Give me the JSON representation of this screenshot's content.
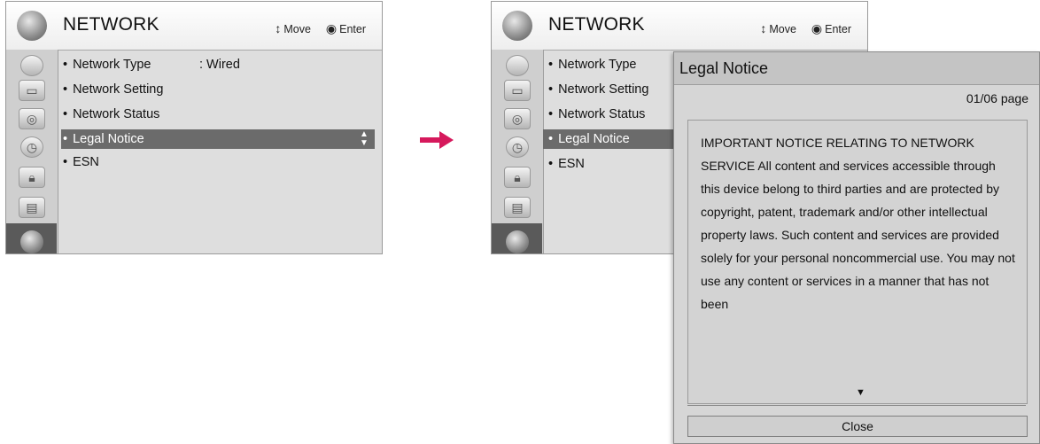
{
  "left_screen": {
    "title": "NETWORK",
    "hint": {
      "move_icon": "move-icon",
      "move_label": "Move",
      "enter_icon": "enter-icon",
      "enter_label": "Enter"
    },
    "menu": [
      {
        "label": "Network Type",
        "value": ": Wired"
      },
      {
        "label": "Network Setting"
      },
      {
        "label": "Network Status"
      },
      {
        "label": "Legal Notice",
        "selected": true
      },
      {
        "label": "ESN"
      }
    ]
  },
  "right_screen": {
    "title": "NETWORK",
    "hint": {
      "move_label": "Move",
      "enter_label": "Enter"
    },
    "menu": [
      {
        "label": "Network Type"
      },
      {
        "label": "Network Setting"
      },
      {
        "label": "Network Status"
      },
      {
        "label": "Legal Notice",
        "selected": true
      },
      {
        "label": "ESN"
      }
    ]
  },
  "popup": {
    "title": "Legal Notice",
    "page": "01/06 page",
    "text": "IMPORTANT NOTICE RELATING TO NETWORK SERVICE All content and services accessible through this device belong to third parties and are protected by copyright, patent, trademark and/or other intellectual property laws. Such content and services are provided solely for your personal noncommercial use. You may not use any content or services in a manner that has not been",
    "close_label": "Close"
  },
  "colors": {
    "arrow": "#d6195c",
    "selected_row": "#6b6b6b",
    "panel_bg": "#dedede"
  }
}
